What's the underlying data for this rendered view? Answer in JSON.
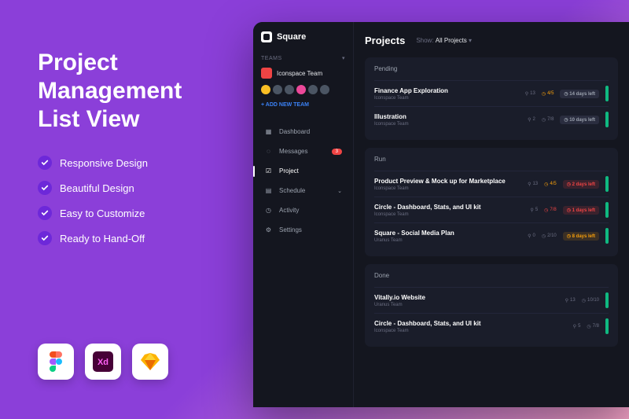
{
  "promo": {
    "title": "Project Management List View",
    "features": [
      "Responsive Design",
      "Beautiful Design",
      "Easy to Customize",
      "Ready to Hand-Off"
    ]
  },
  "app": {
    "brand": "Square",
    "teams_label": "TEAMS",
    "team_name": "Iconspace Team",
    "add_team": "+ ADD NEW TEAM",
    "nav": [
      {
        "label": "Dashboard"
      },
      {
        "label": "Messages",
        "badge": "3"
      },
      {
        "label": "Project"
      },
      {
        "label": "Schedule"
      },
      {
        "label": "Activity"
      },
      {
        "label": "Settings"
      }
    ],
    "page_title": "Projects",
    "filter_label": "Show:",
    "filter_value": "All Projects",
    "sections": [
      {
        "title": "Pending",
        "rows": [
          {
            "title": "Finance App Exploration",
            "team": "Iconspace Team",
            "attach": "13",
            "time": "4/5",
            "time_cls": "warn",
            "due": "14 days left",
            "due_cls": "gray"
          },
          {
            "title": "Illustration",
            "team": "Iconspace Team",
            "attach": "2",
            "time": "7/8",
            "time_cls": "",
            "due": "10 days left",
            "due_cls": "gray"
          }
        ]
      },
      {
        "title": "Run",
        "rows": [
          {
            "title": "Product Preview & Mock up for Marketplace",
            "team": "Iconspace Team",
            "attach": "13",
            "time": "4/5",
            "time_cls": "warn",
            "due": "2 days left",
            "due_cls": "red"
          },
          {
            "title": "Circle - Dashboard, Stats, and UI kit",
            "team": "Iconspace Team",
            "attach": "5",
            "time": "7/8",
            "time_cls": "danger",
            "due": "1 days left",
            "due_cls": "red"
          },
          {
            "title": "Square - Social Media Plan",
            "team": "Uranus Team",
            "attach": "0",
            "time": "2/10",
            "time_cls": "",
            "due": "8 days left",
            "due_cls": "yellow"
          }
        ]
      },
      {
        "title": "Done",
        "rows": [
          {
            "title": "Vitally.io Website",
            "team": "Uranus Team",
            "attach": "13",
            "time": "10/10",
            "time_cls": "",
            "due": "",
            "due_cls": ""
          },
          {
            "title": "Circle - Dashboard, Stats, and UI kit",
            "team": "Iconspace Team",
            "attach": "5",
            "time": "7/8",
            "time_cls": "",
            "due": "",
            "due_cls": ""
          }
        ]
      }
    ]
  }
}
